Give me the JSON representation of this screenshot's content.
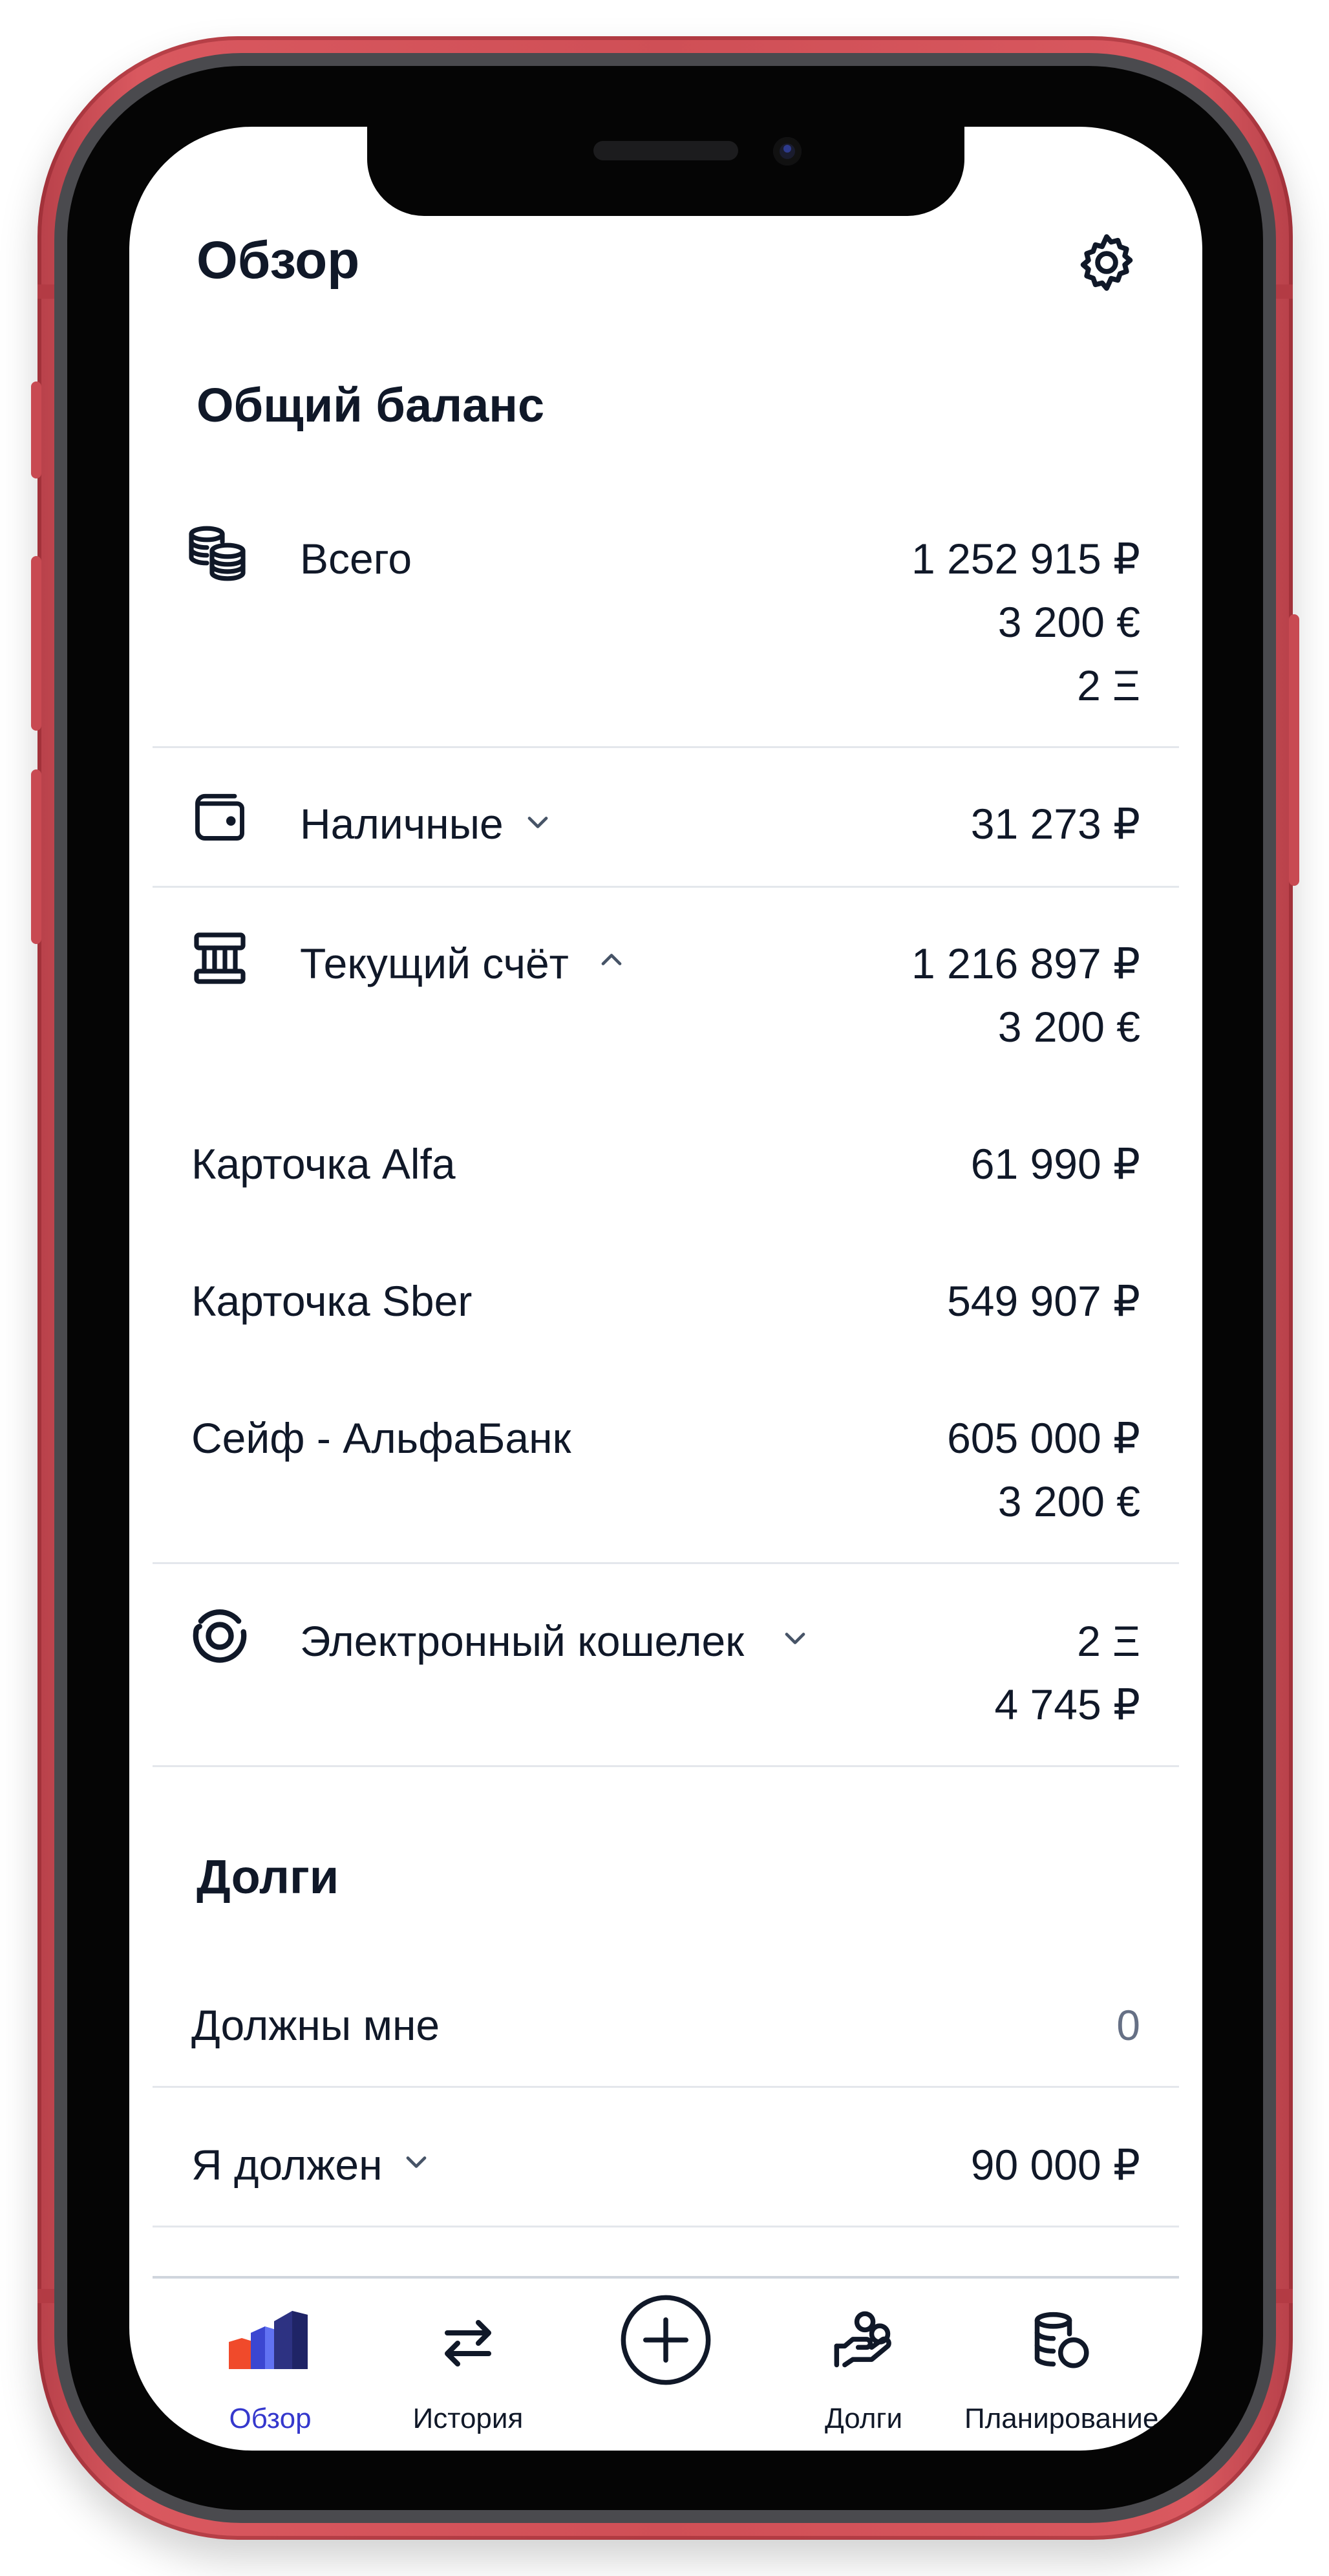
{
  "header": {
    "title": "Обзор"
  },
  "balance": {
    "title": "Общий баланс",
    "total": {
      "label": "Всего",
      "amounts": [
        "1 252 915 ₽",
        "3 200 €",
        "2 Ξ"
      ]
    },
    "cash": {
      "label": "Наличные",
      "amounts": [
        "31 273 ₽"
      ]
    },
    "current_account": {
      "label": "Текущий счёт",
      "amounts": [
        "1 216 897 ₽",
        "3 200 €"
      ],
      "items": [
        {
          "label": "Карточка Alfa",
          "amounts": [
            "61 990 ₽"
          ]
        },
        {
          "label": "Карточка Sber",
          "amounts": [
            "549 907 ₽"
          ]
        },
        {
          "label": "Сейф - АльфаБанк",
          "amounts": [
            "605 000 ₽",
            "3 200 €"
          ]
        }
      ]
    },
    "e_wallet": {
      "label": "Электронный кошелек",
      "amounts": [
        "2 Ξ",
        "4 745 ₽"
      ]
    }
  },
  "debts": {
    "title": "Долги",
    "owed_to_me": {
      "label": "Должны мне",
      "value": "0"
    },
    "i_owe": {
      "label": "Я должен",
      "value": "90 000 ₽"
    }
  },
  "tabbar": {
    "overview": "Обзор",
    "history": "История",
    "debts": "Долги",
    "planning": "Планирование"
  },
  "colors": {
    "accent": "#3538cd",
    "frame": "#d9585f",
    "text": "#101828",
    "muted": "#667085"
  },
  "icons": {
    "settings": "gear-icon",
    "total": "coins-stack-icon",
    "cash": "wallet-icon",
    "account": "bank-icon",
    "ewallet": "orbit-icon",
    "history": "transfer-arrows-icon",
    "add": "plus-circle-icon",
    "debts": "hand-coins-icon",
    "planning": "coins-icon"
  }
}
